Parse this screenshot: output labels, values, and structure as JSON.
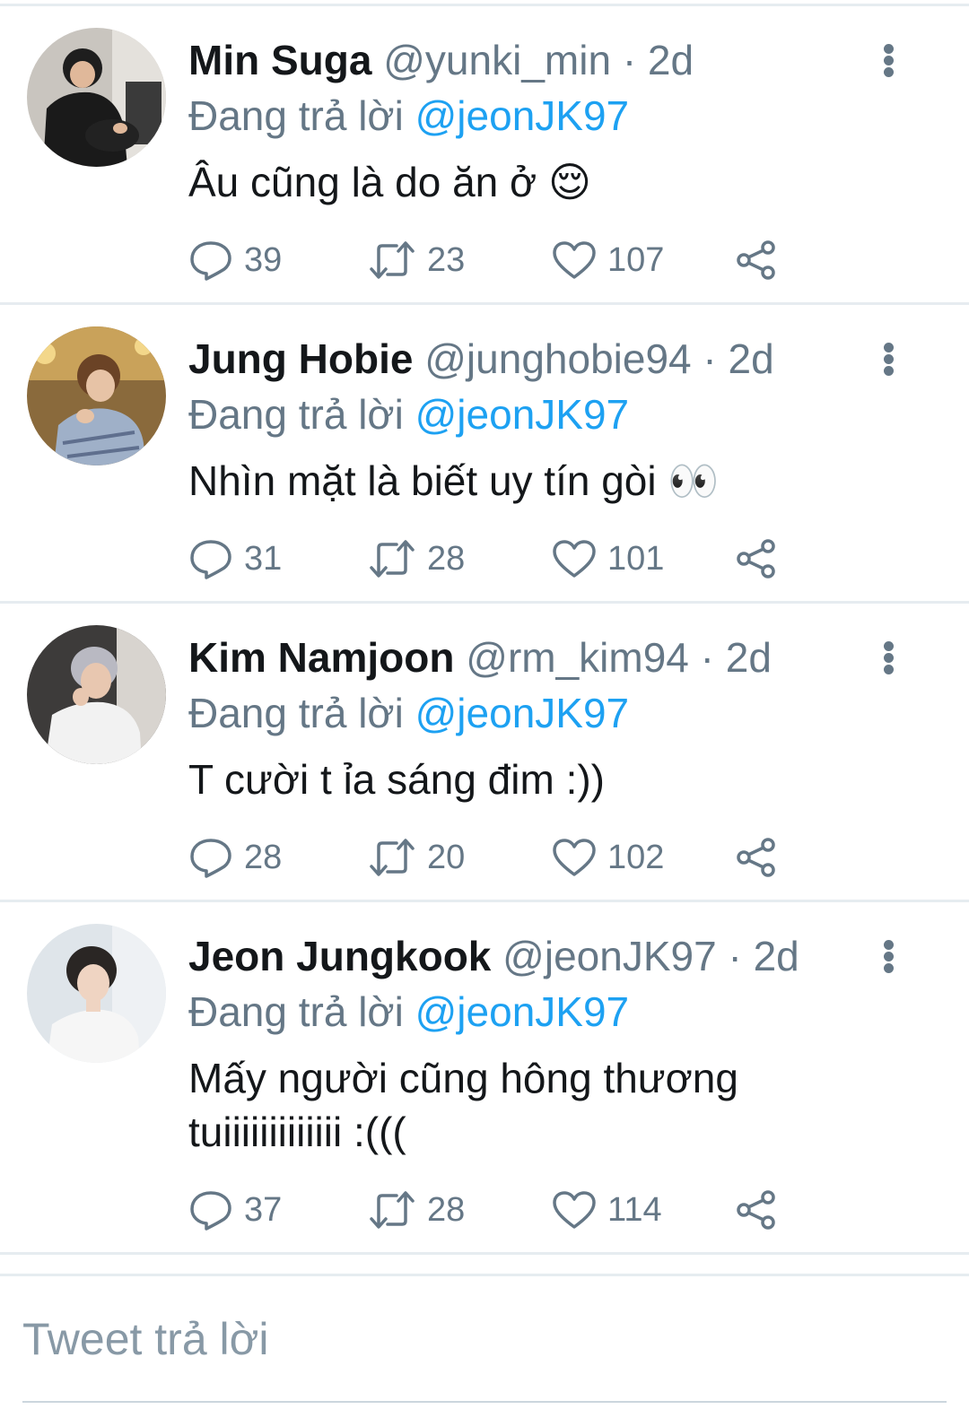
{
  "tweets": [
    {
      "name": "Min Suga",
      "handle": "@yunki_min",
      "separator": "·",
      "time": "2d",
      "reply_prefix": "Đang trả lời",
      "reply_to": "@jeonJK97",
      "text": "Âu cũng là do ăn ở 😌",
      "replies": "39",
      "retweets": "23",
      "likes": "107"
    },
    {
      "name": "Jung Hobie",
      "handle": "@junghobie94",
      "separator": "·",
      "time": "2d",
      "reply_prefix": "Đang trả lời",
      "reply_to": "@jeonJK97",
      "text": "Nhìn mặt là biết uy tín gòi 👀",
      "replies": "31",
      "retweets": "28",
      "likes": "101"
    },
    {
      "name": "Kim Namjoon",
      "handle": "@rm_kim94",
      "separator": "·",
      "time": "2d",
      "reply_prefix": "Đang trả lời",
      "reply_to": "@jeonJK97",
      "text": "T cười t ỉa sáng đim :))",
      "replies": "28",
      "retweets": "20",
      "likes": "102"
    },
    {
      "name": "Jeon Jungkook",
      "handle": "@jeonJK97",
      "separator": "·",
      "time": "2d",
      "reply_prefix": "Đang trả lời",
      "reply_to": "@jeonJK97",
      "text": "Mấy người cũng hông thương tuiiiiiiiiiiiii :(((",
      "replies": "37",
      "retweets": "28",
      "likes": "114"
    }
  ],
  "composer": {
    "placeholder": "Tweet trả lời"
  },
  "icons": {
    "reply": "speech-bubble-icon",
    "retweet": "retweet-arrows-icon",
    "like": "heart-outline-icon",
    "share": "share-nodes-icon",
    "more": "vertical-dots-icon"
  },
  "colors": {
    "mention": "#1da1f2",
    "secondary_text": "#657786",
    "divider": "#e6ecf0"
  }
}
